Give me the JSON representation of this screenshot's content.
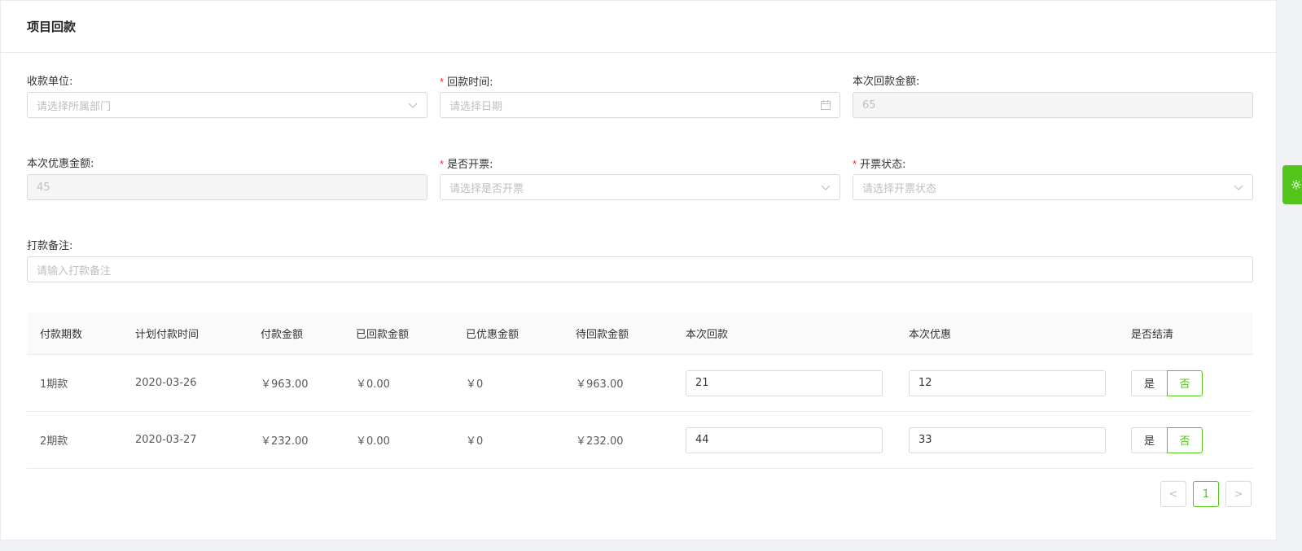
{
  "header": {
    "title": "项目回款"
  },
  "form": {
    "payee": {
      "label": "收款单位:",
      "placeholder": "请选择所属部门"
    },
    "return_time": {
      "label": "回款时间:",
      "placeholder": "请选择日期",
      "required": "*"
    },
    "current_return_amount": {
      "label": "本次回款金额:",
      "value": "65"
    },
    "current_discount_amount": {
      "label": "本次优惠金额:",
      "value": "45"
    },
    "invoice_issued": {
      "label": "是否开票:",
      "placeholder": "请选择是否开票",
      "required": "*"
    },
    "invoice_status": {
      "label": "开票状态:",
      "placeholder": "请选择开票状态",
      "required": "*"
    },
    "payment_note": {
      "label": "打款备注:",
      "placeholder": "请输入打款备注"
    }
  },
  "table": {
    "columns": [
      "付款期数",
      "计划付款时间",
      "付款金额",
      "已回款金额",
      "已优惠金额",
      "待回款金额",
      "本次回款",
      "本次优惠",
      "是否结清"
    ],
    "rows": [
      {
        "period": "1期款",
        "planned_date": "2020-03-26",
        "amount": "￥963.00",
        "returned": "￥0.00",
        "discounted": "￥0",
        "pending": "￥963.00",
        "this_return": "21",
        "this_discount": "12",
        "yes": "是",
        "no": "否",
        "settled": "否"
      },
      {
        "period": "2期款",
        "planned_date": "2020-03-27",
        "amount": "￥232.00",
        "returned": "￥0.00",
        "discounted": "￥0",
        "pending": "￥232.00",
        "this_return": "44",
        "this_discount": "33",
        "yes": "是",
        "no": "否",
        "settled": "否"
      }
    ]
  },
  "pagination": {
    "prev": "<",
    "current": "1",
    "next": ">"
  },
  "colors": {
    "accent": "#52c41a",
    "required": "#f5222d"
  },
  "icons": [
    "chevron-down-icon",
    "calendar-icon",
    "gear-icon"
  ]
}
